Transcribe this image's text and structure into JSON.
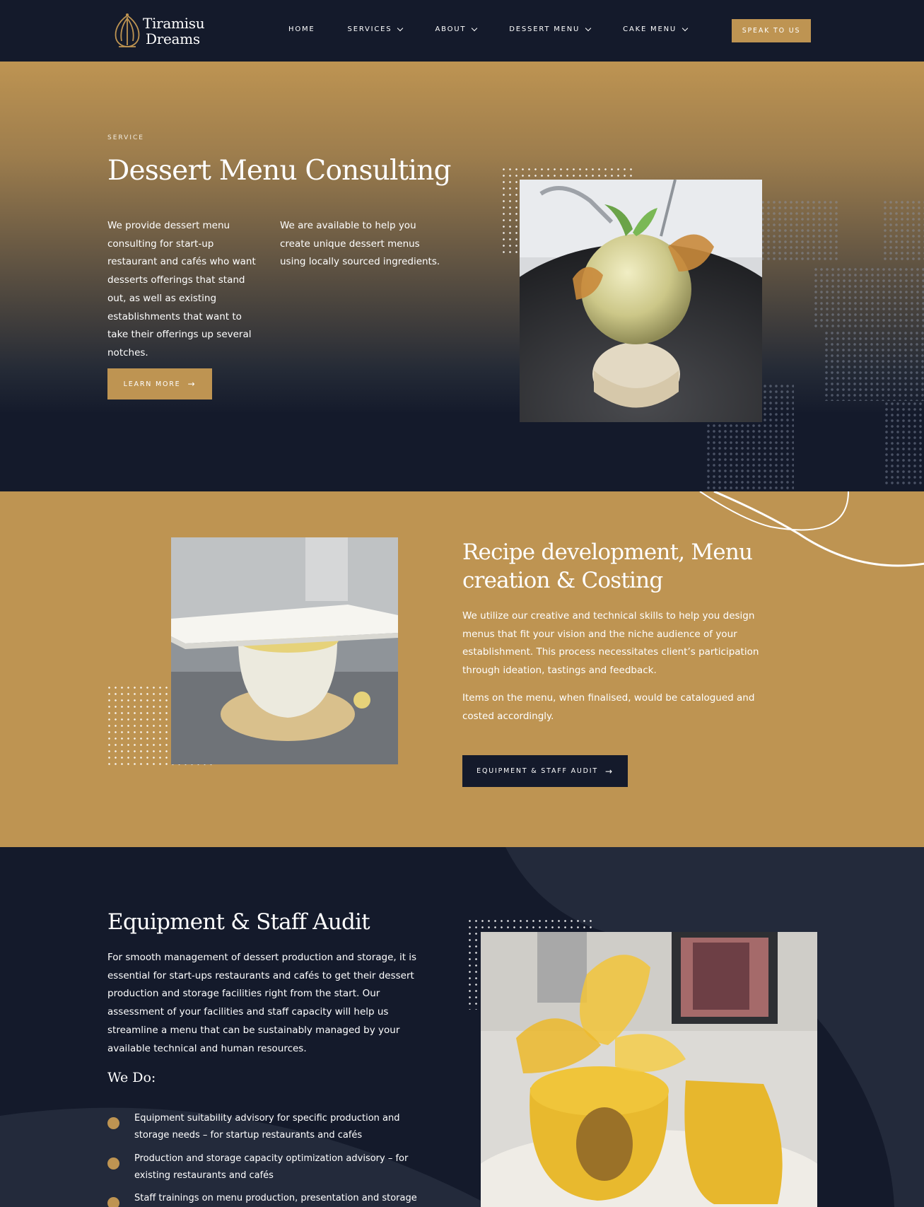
{
  "brand": {
    "line1": "Tiramisu",
    "line2": "Dreams"
  },
  "nav": [
    {
      "label": "HOME",
      "dropdown": false
    },
    {
      "label": "SERVICES",
      "dropdown": true
    },
    {
      "label": "ABOUT",
      "dropdown": true
    },
    {
      "label": "DESSERT MENU",
      "dropdown": true
    },
    {
      "label": "CAKE MENU",
      "dropdown": true
    }
  ],
  "header": {
    "cta": "SPEAK TO US"
  },
  "hero": {
    "eyebrow": "SERVICE",
    "title": "Dessert Menu Consulting",
    "p1": "We provide dessert menu consulting for start-up restaurant and cafés who want desserts offerings that stand out, as well as existing establishments that want to take their offerings up several notches.",
    "p2": "We are available to help you create unique dessert menus using locally sourced ingredients.",
    "button": "LEARN MORE"
  },
  "recipe": {
    "title": "Recipe development, Menu creation & Costing",
    "p1": "We utilize our creative and technical skills to help you design menus that fit your vision and the niche audience of your establishment. This process necessitates client’s participation through ideation, tastings and feedback.",
    "p2": "Items on the menu, when finalised, would be catalogued and costed accordingly.",
    "button": "EQUIPMENT & STAFF AUDIT"
  },
  "audit": {
    "title": "Equipment & Staff Audit",
    "intro": "For smooth management of dessert production and storage, it is essential for start-ups restaurants and cafés to get their dessert production and storage facilities right from the start. Our assessment of your facilities and staff capacity will help us streamline a menu that can be sustainably managed by your available technical and human resources.",
    "subtitle": "We Do:",
    "items": [
      "Equipment suitability advisory for specific production and storage needs – for startup restaurants and cafés",
      "Production and storage capacity optimization advisory – for existing restaurants and cafés",
      "Staff trainings on menu production, presentation and storage"
    ]
  },
  "colors": {
    "navy": "#141a2b",
    "gold": "#be9452"
  }
}
